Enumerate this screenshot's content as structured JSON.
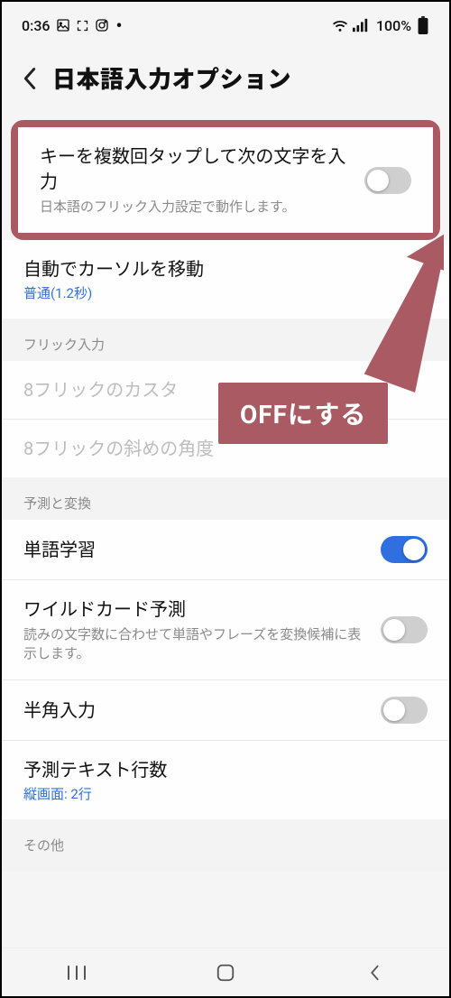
{
  "status": {
    "time": "0:36",
    "battery": "100%"
  },
  "header": {
    "title": "日本語入力オプション"
  },
  "highlighted_item": {
    "title": "キーを複数回タップして次の文字を入力",
    "sub": "日本語のフリック入力設定で動作します。"
  },
  "cursor_item": {
    "title": "自動でカーソルを移動",
    "value": "普通(1.2秒)"
  },
  "section_flick": {
    "header": "フリック入力",
    "item1": "8フリックのカスタ",
    "item2": "8フリックの斜めの角度"
  },
  "section_predict": {
    "header": "予測と変換",
    "word_learning": "単語学習",
    "wildcard_title": "ワイルドカード予測",
    "wildcard_sub": "読みの文字数に合わせて単語やフレーズを変換候補に表示します。",
    "halfwidth": "半角入力",
    "lines_title": "予測テキスト行数",
    "lines_value": "縦画面: 2行"
  },
  "section_other": {
    "header": "その他"
  },
  "annotation": {
    "label": "OFFにする"
  }
}
